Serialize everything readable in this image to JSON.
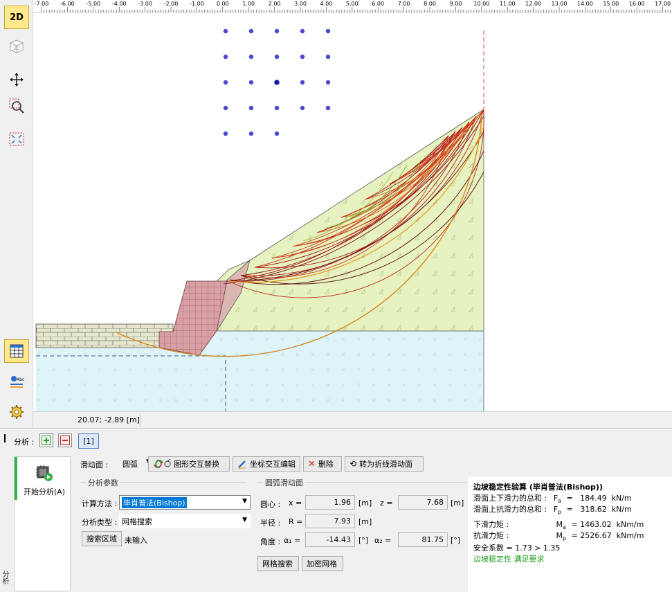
{
  "toolbar": {
    "btn_2d": "2D",
    "btn_3d": "3D",
    "icons": [
      "2d-view",
      "3d-view",
      "move-icon",
      "zoom-window-icon",
      "zoom-extents-icon",
      "table-icon",
      "text-style-icon",
      "settings-icon"
    ]
  },
  "ruler": {
    "ticks": [
      "-7.00",
      "-6.00",
      "-5.00",
      "-4.00",
      "-3.00",
      "-2.00",
      "-1.00",
      "0.00",
      "1.00",
      "2.00",
      "3.00",
      "4.00",
      "5.00",
      "6.00",
      "7.00",
      "8.00",
      "9.00",
      "10.00",
      "11.00",
      "12.00",
      "13.00",
      "14.00",
      "15.00",
      "16.00",
      "17.00"
    ]
  },
  "status": {
    "coords": "20.07; -2.89 [m]"
  },
  "analysis": {
    "label": "分析 :",
    "stage_tab": "[1]",
    "run_button": "开始分析(A)",
    "vertical_tab": "分析"
  },
  "controls": {
    "slip_surface_label": "滑动面 :",
    "slip_surface_value": "圆弧",
    "btn_graphic_swap": "图形交互替换",
    "btn_coord_edit": "坐标交互编辑",
    "btn_delete": "删除",
    "btn_convert": "转为折线滑动面",
    "group_params": "分析参数",
    "method_label": "计算方法 :",
    "method_value": "毕肖普法(Bishop)",
    "type_label": "分析类型 :",
    "type_value": "网格搜索",
    "search_area_btn": "搜索区域",
    "search_area_status": "未输入",
    "group_circle": "圆弧滑动面",
    "center_label": "圆心 :",
    "x_label": "x =",
    "x_value": "1.96",
    "x_unit": "[m]",
    "z_label": "z =",
    "z_value": "7.68",
    "z_unit": "[m]",
    "radius_label": "半径 :",
    "r_label": "R =",
    "r_value": "7.93",
    "r_unit": "[m]",
    "angle_label": "角度 :",
    "a1_label": "α₁ =",
    "a1_value": "-14.43",
    "a1_unit": "[°]",
    "a2_label": "α₂ =",
    "a2_value": "81.75",
    "a2_unit": "[°]",
    "grid_search_btn": "网格搜索",
    "refine_grid_btn": "加密网格"
  },
  "results": {
    "title": "边坡稳定性验算 (毕肖普法(Bishop))",
    "fa_label": "滑面上下滑力的总和 :",
    "fa_sym": "F",
    "fa_sub": "a",
    "fa_value": "=   184.49  kN/m",
    "fp_label": "滑面上抗滑力的总和 :",
    "fp_sym": "F",
    "fp_sub": "p",
    "fp_value": "=   318.62  kN/m",
    "ma_label": "下滑力矩 :",
    "ma_sym": "M",
    "ma_sub": "a",
    "ma_value": "= 1463.02  kNm/m",
    "mp_label": "抗滑力矩 :",
    "mp_sym": "M",
    "mp_sub": "p",
    "mp_value": "= 2526.67  kNm/m",
    "fs_line": "安全系数 = 1.73 > 1.35",
    "verdict": "边坡稳定性 满足要求"
  },
  "colors": {
    "accent": "#0078d7",
    "run_green": "#33b347",
    "slope_fill": "#e6f2c0",
    "water_fill": "#dff4f8",
    "wall_fill": "#d8a0a4",
    "critical_arc": "#d8861c",
    "arc_red": "#c02020",
    "grid_dot": "#4a4ad0"
  }
}
